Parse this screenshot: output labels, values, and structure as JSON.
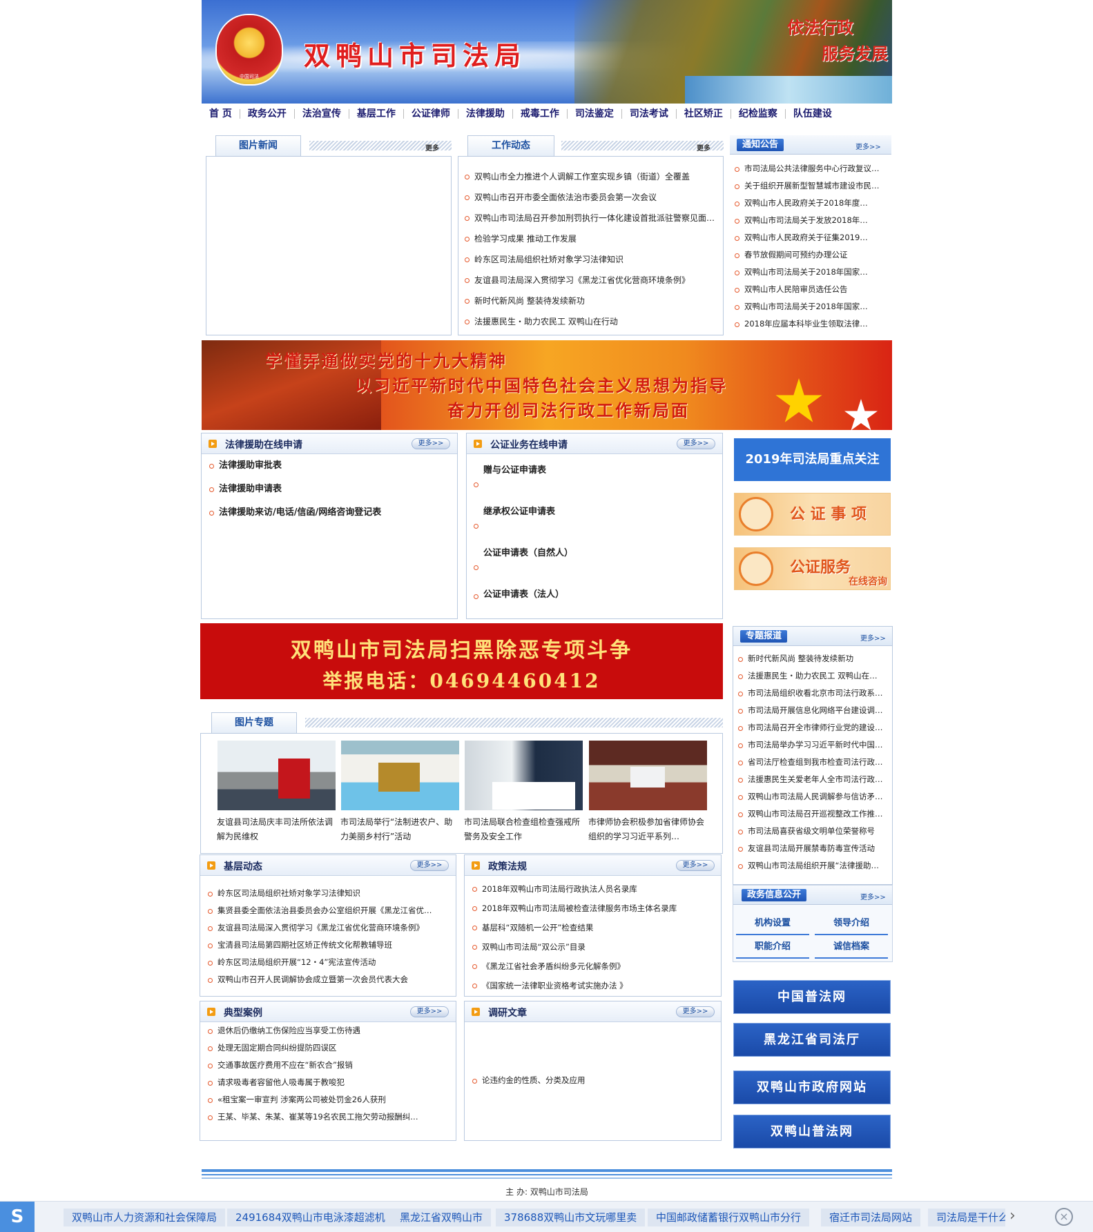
{
  "header": {
    "site_title": "双鸭山市司法局",
    "slogan_line1": "依法行政",
    "slogan_line2": "服务发展",
    "emblem_caption": "中国司法"
  },
  "nav": [
    "首 页",
    "政务公开",
    "法治宣传",
    "基层工作",
    "公证律师",
    "法律援助",
    "戒毒工作",
    "司法鉴定",
    "司法考试",
    "社区矫正",
    "纪检监察",
    "队伍建设"
  ],
  "photo_news": {
    "title": "图片新闻",
    "more": "更多"
  },
  "work_news": {
    "title": "工作动态",
    "more": "更多",
    "items": [
      "双鸭山市全力推进个人调解工作室实现乡镇（街道）全覆盖",
      "双鸭山市召开市委全面依法治市委员会第一次会议",
      "双鸭山市司法局召开参加刑罚执行一体化建设首批派驻警察见面…",
      "检验学习成果 推动工作发展",
      "岭东区司法局组织社矫对象学习法律知识",
      "友谊县司法局深入贯彻学习《黑龙江省优化营商环境条例》",
      "新时代新风尚 整装待发续新功",
      "法援惠民生・助力农民工 双鸭山在行动"
    ]
  },
  "notice": {
    "title": "通知公告",
    "more": "更多>>",
    "items": [
      "市司法局公共法律服务中心行政复议…",
      "关于组织开展新型智慧城市建设市民…",
      "双鸭山市人民政府关于2018年度…",
      "双鸭山市司法局关于发放2018年…",
      "双鸭山市人民政府关于征集2019…",
      "春节放假期间可预约办理公证",
      "双鸭山市司法局关于2018年国家…",
      "双鸭山市人民陪审员选任公告",
      "双鸭山市司法局关于2018年国家…",
      "2018年应届本科毕业生领取法律…"
    ]
  },
  "banner1": {
    "line1": "学懂弄通做实党的十九大精神",
    "line2": "以习近平新时代中国特色社会主义思想为指导",
    "line3": "奋力开创司法行政工作新局面"
  },
  "legal_aid": {
    "title": "法律援助在线申请",
    "more": "更多>>",
    "items": [
      "法律援助审批表",
      "法律援助申请表",
      "法律援助来访/电话/信函/网络咨询登记表"
    ]
  },
  "notary_apply": {
    "title": "公证业务在线申请",
    "more": "更多>>",
    "items": [
      "赠与公证申请表",
      "继承权公证申请表",
      "公证申请表（自然人）",
      "公证申请表（法人）"
    ]
  },
  "right_promos": {
    "focus": "2019年司法局重点关注",
    "notary_items": "公 证 事 项",
    "notary_service": "公证服务",
    "notary_service_sub": "在线咨询"
  },
  "banner2": {
    "line1": "双鸭山市司法局扫黑除恶专项斗争",
    "line2": "举报电话：04694460412"
  },
  "special": {
    "title": "专题报道",
    "more": "更多>>",
    "items": [
      "新时代新风尚 整装待发续新功",
      "法援惠民生・助力农民工 双鸭山在…",
      "市司法局组织收看北京市司法行政系…",
      "市司法局开展信息化网络平台建设调…",
      "市司法局召开全市律师行业党的建设…",
      "市司法局举办学习习近平新时代中国…",
      "省司法厅检查组到我市检查司法行政…",
      "法援惠民生关爱老年人全市司法行政…",
      "双鸭山市司法局人民调解参与信访矛…",
      "双鸭山市司法局召开巡视整改工作推…",
      "市司法局喜获省级文明单位荣誉称号",
      "友谊县司法局开展禁毒防毒宣传活动",
      "双鸭山市司法局组织开展“法律援助…"
    ]
  },
  "photo_topic": {
    "title": "图片专题",
    "captions": [
      "友谊县司法局庆丰司法所依法调解为民维权",
      "市司法局举行“法制进农户、助力美丽乡村行”活动",
      "市司法局联合检查组检查强戒所警务及安全工作",
      "市律师协会积极参加省律师协会组织的学习习近平系列…"
    ]
  },
  "gov_info": {
    "title": "政务信息公开",
    "more": "更多>>",
    "links": [
      "机构设置",
      "领导介绍",
      "职能介绍",
      "诚信档案"
    ]
  },
  "grassroots": {
    "title": "基层动态",
    "more": "更多>>",
    "items": [
      "岭东区司法局组织社矫对象学习法律知识",
      "集贤县委全面依法治县委员会办公室组织开展《黑龙江省优…",
      "友谊县司法局深入贯彻学习《黑龙江省优化营商环境条例》",
      "宝清县司法局第四期社区矫正传统文化帮教辅导班",
      "岭东区司法局组织开展“12・4”宪法宣传活动",
      "双鸭山市召开人民调解协会成立暨第一次会员代表大会"
    ]
  },
  "policy": {
    "title": "政策法规",
    "more": "更多>>",
    "items": [
      "2018年双鸭山市司法局行政执法人员名录库",
      "2018年双鸭山市司法局被检查法律服务市场主体名录库",
      "基层科“双随机一公开”检查结果",
      "双鸭山市司法局“双公示”目录",
      "《黑龙江省社会矛盾纠纷多元化解条例》",
      "《国家统一法律职业资格考试实施办法 》"
    ]
  },
  "cases": {
    "title": "典型案例",
    "more": "更多>>",
    "items": [
      "退休后仍缴纳工伤保险应当享受工伤待遇",
      "处理无固定期合同纠纷提防四误区",
      "交通事故医疗费用不应在“新农合”报销",
      "请求吸毒者容留他人吸毒属于教唆犯",
      "«租宝案一审宣判 涉案两公司被处罚金26人获刑",
      "王某、毕某、朱某、崔某等19名农民工拖欠劳动报酬纠…"
    ]
  },
  "research": {
    "title": "调研文章",
    "more": "更多>>",
    "items": [
      "论违约金的性质、分类及应用"
    ]
  },
  "links": [
    "中国普法网",
    "黑龙江省司法厅",
    "双鸭山市政府网站",
    "双鸭山普法网"
  ],
  "footer": {
    "sponsor": "主 办: 双鸭山市司法局"
  },
  "bottom_bar": {
    "items": [
      "双鸭山市人力资源和社会保障局",
      "2491684双鸭山市电泳漆超滤机",
      "黑龙江省双鸭山市",
      "378688双鸭山市文玩哪里卖",
      "中国邮政储蓄银行双鸭山市分行",
      "宿迁市司法局网站",
      "司法局是干什么"
    ],
    "logo": "S"
  }
}
